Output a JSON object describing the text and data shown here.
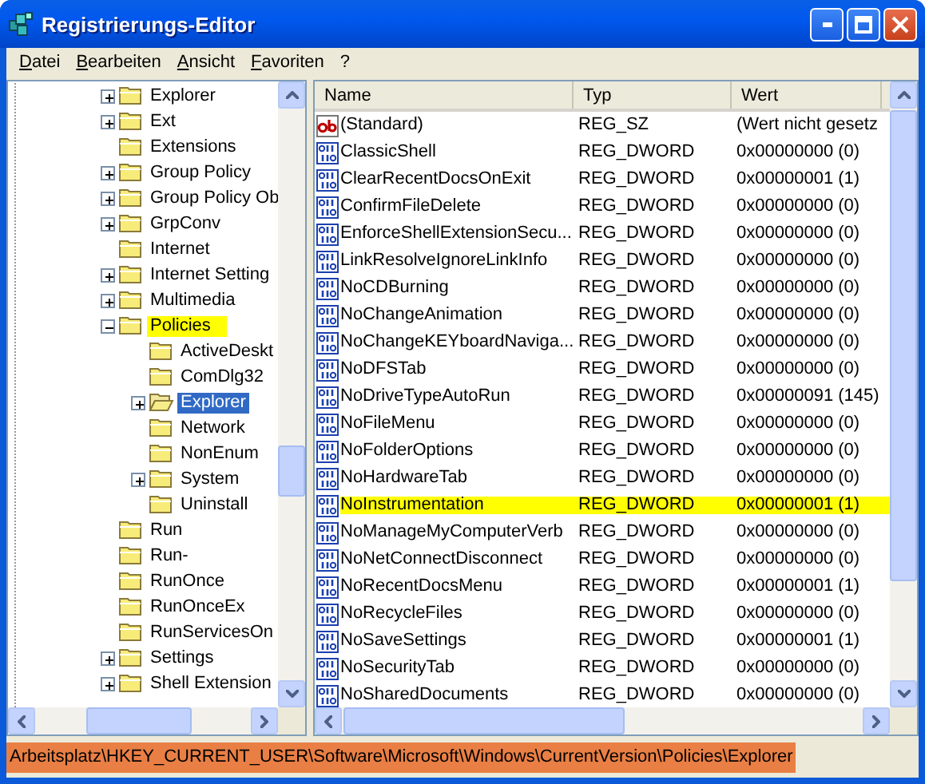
{
  "window": {
    "title": "Registrierungs-Editor"
  },
  "menu": [
    {
      "label": "Datei"
    },
    {
      "label": "Bearbeiten"
    },
    {
      "label": "Ansicht"
    },
    {
      "label": "Favoriten"
    },
    {
      "label": "?"
    }
  ],
  "tree": [
    {
      "label": "Explorer",
      "expanded": false,
      "selected": false,
      "highlighted": false
    },
    {
      "label": "Ext",
      "expanded": false,
      "selected": false,
      "highlighted": false
    },
    {
      "label": "Extensions",
      "selected": false,
      "highlighted": false
    },
    {
      "label": "Group Policy",
      "expanded": false,
      "selected": false,
      "highlighted": false
    },
    {
      "label": "Group Policy Ob",
      "expanded": false,
      "selected": false,
      "highlighted": false
    },
    {
      "label": "GrpConv",
      "expanded": false,
      "selected": false,
      "highlighted": false
    },
    {
      "label": "Internet",
      "selected": false,
      "highlighted": false
    },
    {
      "label": "Internet Setting",
      "expanded": false,
      "selected": false,
      "highlighted": false
    },
    {
      "label": "Multimedia",
      "expanded": false,
      "selected": false,
      "highlighted": false
    },
    {
      "label": "Policies",
      "expanded": true,
      "selected": false,
      "highlighted": true,
      "children": [
        {
          "label": "ActiveDeskt",
          "selected": false,
          "highlighted": false
        },
        {
          "label": "ComDlg32",
          "selected": false,
          "highlighted": false
        },
        {
          "label": "Explorer",
          "expanded": false,
          "selected": true,
          "highlighted": false
        },
        {
          "label": "Network",
          "selected": false,
          "highlighted": false
        },
        {
          "label": "NonEnum",
          "selected": false,
          "highlighted": false
        },
        {
          "label": "System",
          "expanded": false,
          "selected": false,
          "highlighted": false
        },
        {
          "label": "Uninstall",
          "selected": false,
          "highlighted": false
        }
      ]
    },
    {
      "label": "Run",
      "selected": false,
      "highlighted": false
    },
    {
      "label": "Run-",
      "selected": false,
      "highlighted": false
    },
    {
      "label": "RunOnce",
      "selected": false,
      "highlighted": false
    },
    {
      "label": "RunOnceEx",
      "selected": false,
      "highlighted": false
    },
    {
      "label": "RunServicesOn",
      "selected": false,
      "highlighted": false
    },
    {
      "label": "Settings",
      "expanded": false,
      "selected": false,
      "highlighted": false
    },
    {
      "label": "Shell Extension",
      "expanded": false,
      "selected": false,
      "highlighted": false
    }
  ],
  "list": {
    "columns": [
      "Name",
      "Typ",
      "Wert"
    ],
    "rows": [
      {
        "kind": "string",
        "name": "(Standard)",
        "type": "REG_SZ",
        "value": "(Wert nicht gesetz",
        "highlighted": false
      },
      {
        "kind": "dword",
        "name": "ClassicShell",
        "type": "REG_DWORD",
        "value": "0x00000000 (0)",
        "highlighted": false
      },
      {
        "kind": "dword",
        "name": "ClearRecentDocsOnExit",
        "type": "REG_DWORD",
        "value": "0x00000001 (1)",
        "highlighted": false
      },
      {
        "kind": "dword",
        "name": "ConfirmFileDelete",
        "type": "REG_DWORD",
        "value": "0x00000000 (0)",
        "highlighted": false
      },
      {
        "kind": "dword",
        "name": "EnforceShellExtensionSecu...",
        "type": "REG_DWORD",
        "value": "0x00000000 (0)",
        "highlighted": false
      },
      {
        "kind": "dword",
        "name": "LinkResolveIgnoreLinkInfo",
        "type": "REG_DWORD",
        "value": "0x00000000 (0)",
        "highlighted": false
      },
      {
        "kind": "dword",
        "name": "NoCDBurning",
        "type": "REG_DWORD",
        "value": "0x00000000 (0)",
        "highlighted": false
      },
      {
        "kind": "dword",
        "name": "NoChangeAnimation",
        "type": "REG_DWORD",
        "value": "0x00000000 (0)",
        "highlighted": false
      },
      {
        "kind": "dword",
        "name": "NoChangeKEYboardNaviga...",
        "type": "REG_DWORD",
        "value": "0x00000000 (0)",
        "highlighted": false
      },
      {
        "kind": "dword",
        "name": "NoDFSTab",
        "type": "REG_DWORD",
        "value": "0x00000000 (0)",
        "highlighted": false
      },
      {
        "kind": "dword",
        "name": "NoDriveTypeAutoRun",
        "type": "REG_DWORD",
        "value": "0x00000091 (145)",
        "highlighted": false
      },
      {
        "kind": "dword",
        "name": "NoFileMenu",
        "type": "REG_DWORD",
        "value": "0x00000000 (0)",
        "highlighted": false
      },
      {
        "kind": "dword",
        "name": "NoFolderOptions",
        "type": "REG_DWORD",
        "value": "0x00000000 (0)",
        "highlighted": false
      },
      {
        "kind": "dword",
        "name": "NoHardwareTab",
        "type": "REG_DWORD",
        "value": "0x00000000 (0)",
        "highlighted": false
      },
      {
        "kind": "dword",
        "name": "NoInstrumentation",
        "type": "REG_DWORD",
        "value": "0x00000001 (1)",
        "highlighted": true
      },
      {
        "kind": "dword",
        "name": "NoManageMyComputerVerb",
        "type": "REG_DWORD",
        "value": "0x00000000 (0)",
        "highlighted": false
      },
      {
        "kind": "dword",
        "name": "NoNetConnectDisconnect",
        "type": "REG_DWORD",
        "value": "0x00000000 (0)",
        "highlighted": false
      },
      {
        "kind": "dword",
        "name": "NoRecentDocsMenu",
        "type": "REG_DWORD",
        "value": "0x00000001 (1)",
        "highlighted": false
      },
      {
        "kind": "dword",
        "name": "NoRecycleFiles",
        "type": "REG_DWORD",
        "value": "0x00000000 (0)",
        "highlighted": false
      },
      {
        "kind": "dword",
        "name": "NoSaveSettings",
        "type": "REG_DWORD",
        "value": "0x00000001 (1)",
        "highlighted": false
      },
      {
        "kind": "dword",
        "name": "NoSecurityTab",
        "type": "REG_DWORD",
        "value": "0x00000000 (0)",
        "highlighted": false
      },
      {
        "kind": "dword",
        "name": "NoSharedDocuments",
        "type": "REG_DWORD",
        "value": "0x00000000 (0)",
        "highlighted": false
      }
    ]
  },
  "status_bar": {
    "path": "Arbeitsplatz\\HKEY_CURRENT_USER\\Software\\Microsoft\\Windows\\CurrentVersion\\Policies\\Explorer",
    "highlighted": true
  }
}
